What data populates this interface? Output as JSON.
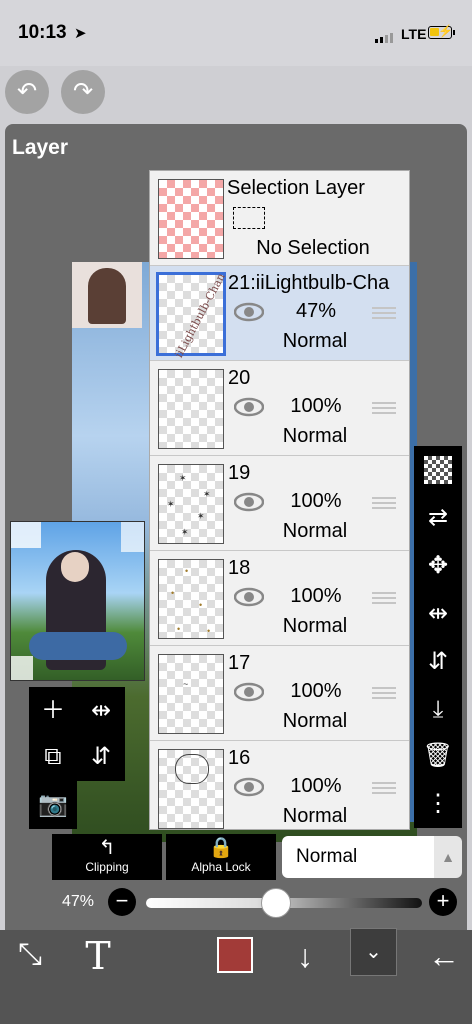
{
  "status_bar": {
    "time": "10:13",
    "carrier": "LTE"
  },
  "panel": {
    "title": "Layer"
  },
  "layers": [
    {
      "name": "Selection Layer",
      "status": "No Selection",
      "type": "selection"
    },
    {
      "name": "21:iiLightbulb-Cha",
      "opacity": "47%",
      "blend": "Normal",
      "selected": true,
      "thumb_text": "iiLightbulb-Chan"
    },
    {
      "name": "20",
      "opacity": "100%",
      "blend": "Normal"
    },
    {
      "name": "19",
      "opacity": "100%",
      "blend": "Normal"
    },
    {
      "name": "18",
      "opacity": "100%",
      "blend": "Normal"
    },
    {
      "name": "17",
      "opacity": "100%",
      "blend": "Normal"
    },
    {
      "name": "16",
      "opacity": "100%",
      "blend": "Normal"
    }
  ],
  "controls": {
    "clipping_label": "Clipping",
    "alpha_lock_label": "Alpha Lock",
    "blend_mode": "Normal",
    "opacity_label": "47%",
    "opacity_value": 0.47
  },
  "colors": {
    "current_color": "#a23b38",
    "selected_layer_bg": "#d3dff0",
    "selected_border": "#3b6fd8"
  },
  "icons": {
    "text_tool": "T"
  }
}
